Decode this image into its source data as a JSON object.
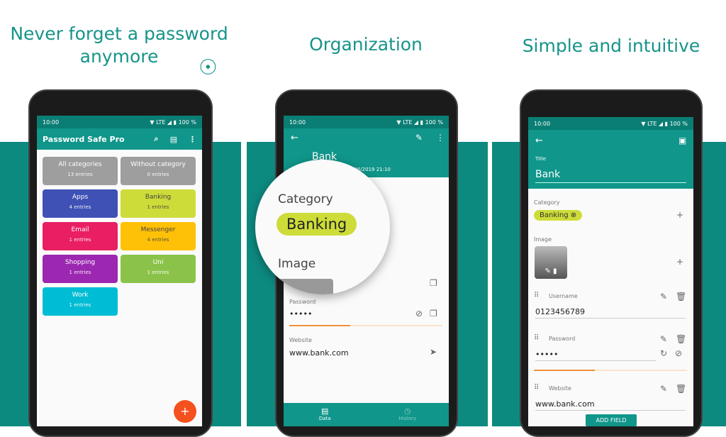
{
  "headlines": {
    "one": "Never forget a password anymore",
    "two": "Organization",
    "three": "Simple and intuitive"
  },
  "colors": {
    "brand": "#10968a",
    "band": "#0d8a80",
    "fab": "#f4511e"
  },
  "status": {
    "time": "10:00",
    "signal": "▼ LTE ◢ ▮",
    "battery": "100 %"
  },
  "screen1": {
    "title": "Password Safe Pro",
    "icons": [
      "search-icon",
      "list-view-icon",
      "more-vert-icon"
    ],
    "categories": [
      {
        "name": "All categories",
        "count": "13 entries",
        "color": "#9e9e9e"
      },
      {
        "name": "Without category",
        "count": "0 entries",
        "color": "#9e9e9e"
      },
      {
        "name": "Apps",
        "count": "4 entries",
        "color": "#3f51b5"
      },
      {
        "name": "Banking",
        "count": "1 entries",
        "color": "#cddc39"
      },
      {
        "name": "Email",
        "count": "1 entries",
        "color": "#e91e63"
      },
      {
        "name": "Messenger",
        "count": "4 entries",
        "color": "#ffc107"
      },
      {
        "name": "Shopping",
        "count": "1 entries",
        "color": "#9c27b0"
      },
      {
        "name": "Uni",
        "count": "1 entries",
        "color": "#8bc34a"
      },
      {
        "name": "Work",
        "count": "1 entries",
        "color": "#00bcd4"
      }
    ],
    "fab": "+"
  },
  "screen2": {
    "title": "Bank",
    "updated": "Last updated 22/06/2019 21:10",
    "category_label": "Category",
    "category": "Banking",
    "image_label": "Image",
    "password_label": "Password",
    "password": "•••••",
    "password_strength": 0.4,
    "website_label": "Website",
    "website": "www.bank.com",
    "tabs": [
      {
        "label": "Data"
      },
      {
        "label": "History"
      }
    ]
  },
  "screen3": {
    "title_label": "Title",
    "title": "Bank",
    "category_label": "Category",
    "category": "Banking",
    "image_label": "Image",
    "fields": [
      {
        "label": "Username",
        "value": "0123456789"
      },
      {
        "label": "Password",
        "value": "•••••"
      },
      {
        "label": "Website",
        "value": "www.bank.com"
      }
    ],
    "password_strength": 0.4,
    "add_field": "ADD FIELD"
  }
}
